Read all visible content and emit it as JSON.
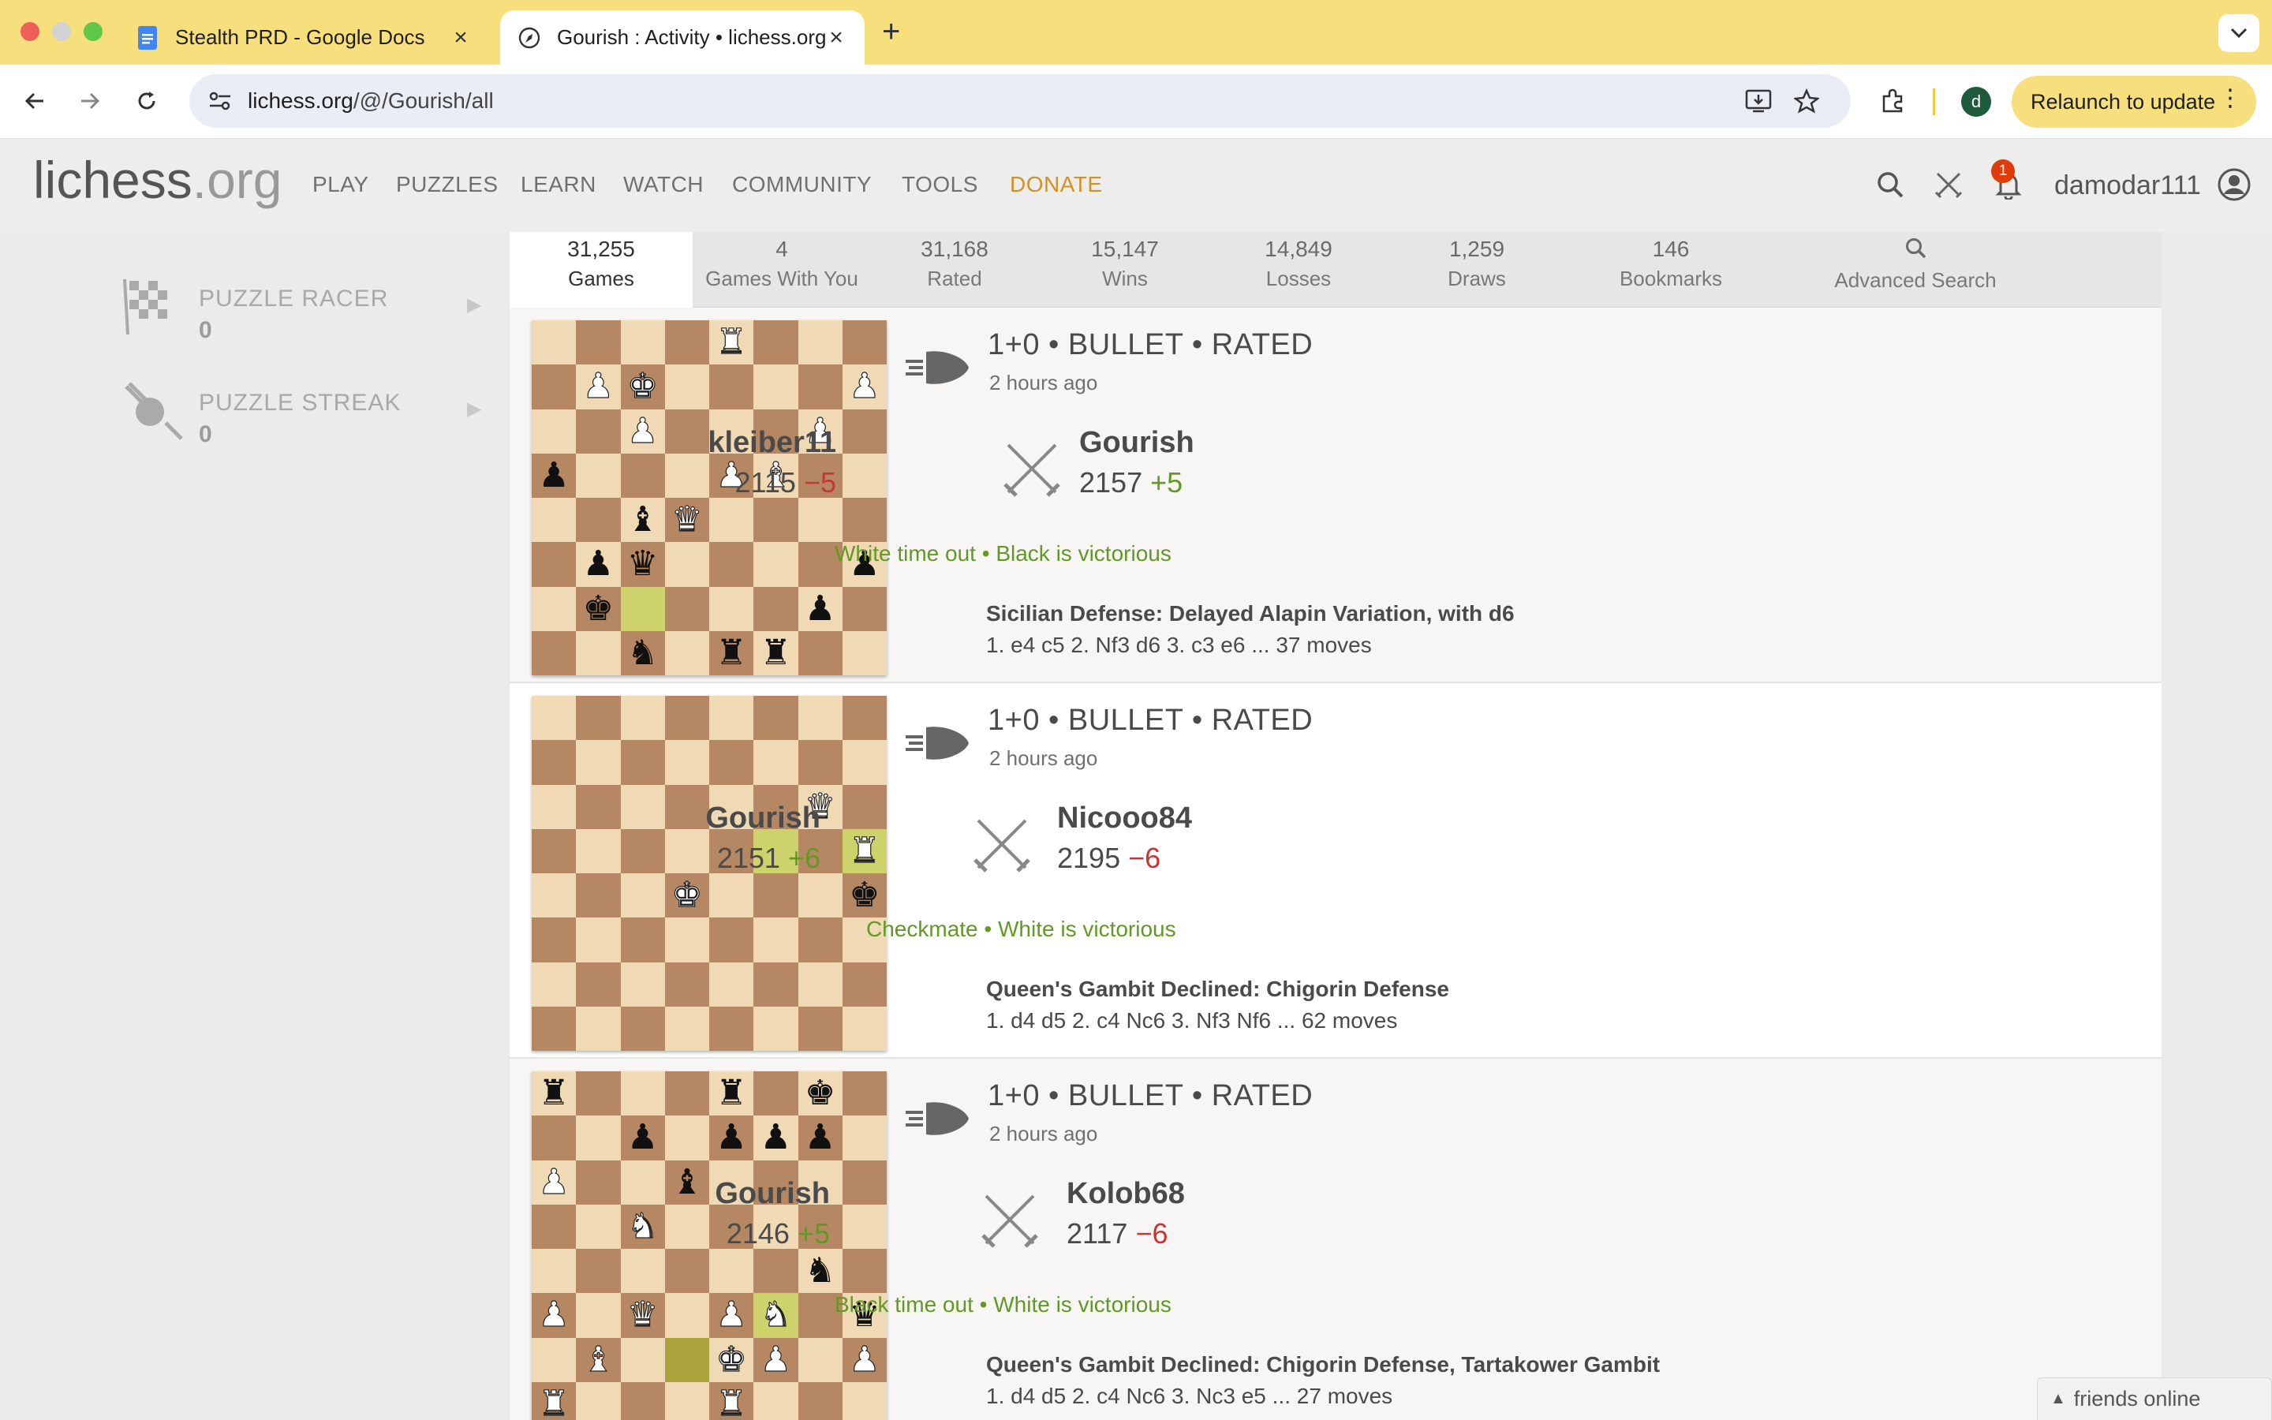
{
  "browser": {
    "tabs": [
      {
        "title": "Stealth PRD - Google Docs",
        "icon": "google-docs-icon"
      },
      {
        "title": "Gourish : Activity • lichess.org",
        "icon": "lichess-icon"
      }
    ],
    "url_domain": "lichess.org",
    "url_path": "/@/Gourish/all",
    "profile_initial": "d",
    "relaunch_label": "Relaunch to update"
  },
  "site": {
    "logo_main": "lichess",
    "logo_ext": ".org",
    "nav": [
      "PLAY",
      "PUZZLES",
      "LEARN",
      "WATCH",
      "COMMUNITY",
      "TOOLS",
      "DONATE"
    ],
    "notification_count": "1",
    "username": "damodar111",
    "accent": "#d59120"
  },
  "sidebar": {
    "items": [
      {
        "label": "PUZZLE RACER",
        "count": "0",
        "icon": "puzzle-racer-icon"
      },
      {
        "label": "PUZZLE STREAK",
        "count": "0",
        "icon": "puzzle-streak-icon"
      }
    ]
  },
  "stats": [
    {
      "num": "31,255",
      "label": "Games"
    },
    {
      "num": "4",
      "label": "Games With You"
    },
    {
      "num": "31,168",
      "label": "Rated"
    },
    {
      "num": "15,147",
      "label": "Wins"
    },
    {
      "num": "14,849",
      "label": "Losses"
    },
    {
      "num": "1,259",
      "label": "Draws"
    },
    {
      "num": "146",
      "label": "Bookmarks"
    },
    {
      "num": "",
      "label": "Advanced Search"
    }
  ],
  "games": [
    {
      "header": "1+0 • BULLET • RATED",
      "time": "2 hours ago",
      "white": {
        "name": "kleiber11",
        "rating": "2115",
        "diff": "−5"
      },
      "black": {
        "name": "Gourish",
        "rating": "2157",
        "diff": "+5"
      },
      "result_a": "White time out",
      "result_b": "Black is victorious",
      "opening": "Sicilian Defense: Delayed Alapin Variation, with d6",
      "moves": "1. e4 c5 2. Nf3 d6 3. c3 e6 ... 37 moves",
      "board": [
        "....R...",
        ".PK....P",
        "..P...P.",
        "p...PB..",
        "..bQ....",
        ".pq....p",
        ".k....p.",
        "..n.rr.."
      ],
      "highlights": [
        [
          6,
          2
        ]
      ]
    },
    {
      "header": "1+0 • BULLET • RATED",
      "time": "2 hours ago",
      "white": {
        "name": "Gourish",
        "rating": "2151",
        "diff": "+6"
      },
      "black": {
        "name": "Nicooo84",
        "rating": "2195",
        "diff": "−6"
      },
      "result_a": "Checkmate",
      "result_b": "White is victorious",
      "opening": "Queen's Gambit Declined: Chigorin Defense",
      "moves": "1. d4 d5 2. c4 Nc6 3. Nf3 Nf6 ... 62 moves",
      "board": [
        "........",
        "........",
        "......Q.",
        ".......R",
        "...K...k",
        "........",
        "........",
        "........"
      ],
      "highlights": [
        [
          3,
          5
        ],
        [
          3,
          7
        ]
      ]
    },
    {
      "header": "1+0 • BULLET • RATED",
      "time": "2 hours ago",
      "white": {
        "name": "Gourish",
        "rating": "2146",
        "diff": "+5"
      },
      "black": {
        "name": "Kolob68",
        "rating": "2117",
        "diff": "−6"
      },
      "result_a": "Black time out",
      "result_b": "White is victorious",
      "opening": "Queen's Gambit Declined: Chigorin Defense, Tartakower Gambit",
      "moves": "1. d4 d5 2. c4 Nc6 3. Nc3 e5 ... 27 moves",
      "board": [
        "r...r.k.",
        "..p.ppp.",
        "P..b....",
        "..N.....",
        "......n.",
        "P.Q.PN.q",
        ".B..KP.P",
        "R...R..."
      ],
      "highlights": [
        [
          5,
          5
        ],
        [
          6,
          3
        ]
      ]
    }
  ],
  "friends_label": "friends online"
}
